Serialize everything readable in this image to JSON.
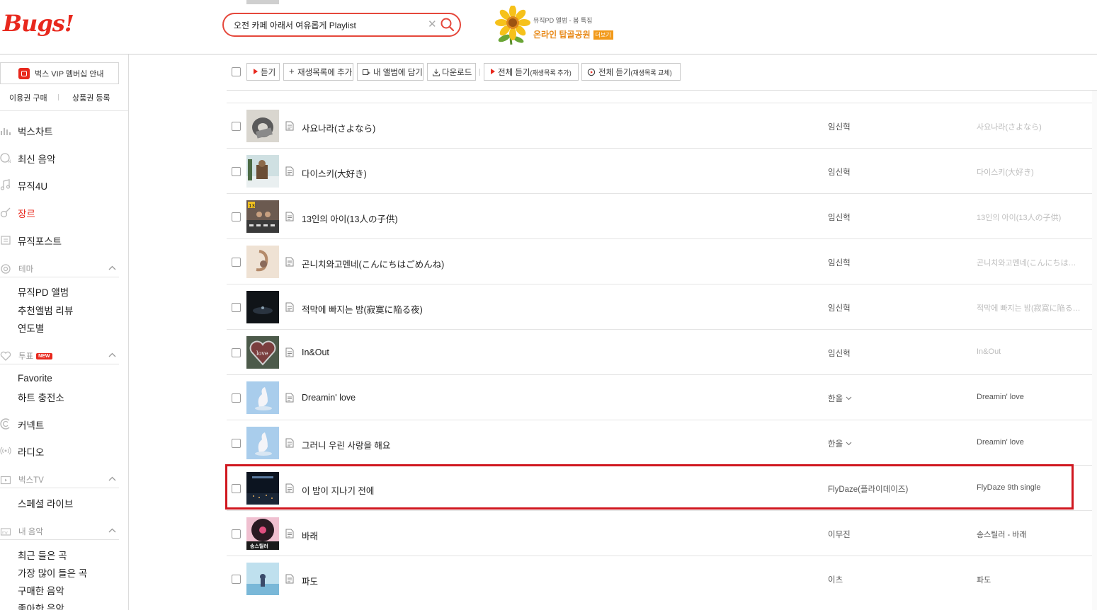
{
  "header": {
    "logo": "Bugs!",
    "search": {
      "value": "오전 카페 아래서 여유롭게 Playlist",
      "placeholder": ""
    },
    "banner": {
      "subtitle": "뮤직PD 앨범 - 봄 특집",
      "title": "온라인 탑골공원",
      "more": "더보기"
    }
  },
  "sidebar": {
    "vip": "벅스 VIP 멤버십 안내",
    "buy": "이용권 구매",
    "coupon": "상품권 등록",
    "nav": [
      "벅스차트",
      "최신 음악",
      "뮤직4U",
      "장르",
      "뮤직포스트"
    ],
    "theme": {
      "label": "테마",
      "items": [
        "뮤직PD 앨범",
        "추천앨범 리뷰",
        "연도별"
      ]
    },
    "vote": {
      "label": "투표",
      "badge": "NEW",
      "items": [
        "Favorite",
        "하트 충전소"
      ]
    },
    "connect": "커넥트",
    "radio": "라디오",
    "bugstv": {
      "label": "벅스TV",
      "items": [
        "스페셜 라이브"
      ]
    },
    "mymusic": {
      "label": "내 음악",
      "items": [
        "최근 들은 곡",
        "가장 많이 들은 곡",
        "구매한 음악",
        "좋아한 음악"
      ]
    }
  },
  "toolbar": {
    "listen": "듣기",
    "add_playlist": "재생목록에 추가",
    "add_album": "내 앨범에 담기",
    "download": "다운로드",
    "listen_all_add": "전체 듣기",
    "listen_all_add_small": "(재생목록 추가)",
    "listen_all_replace": "전체 듣기",
    "listen_all_replace_small": "(재생목록 교체)"
  },
  "tracks": [
    {
      "title": "사요나라(さよなら)",
      "artist": "임신혁",
      "album": "사요나라(さよなら)",
      "artist_more": false,
      "album_dark": false
    },
    {
      "title": "다이스키(大好き)",
      "artist": "임신혁",
      "album": "다이스키(大好き)",
      "artist_more": false,
      "album_dark": false
    },
    {
      "title": "13인의 아이(13人の子供)",
      "artist": "임신혁",
      "album": "13인의 아이(13人の子供)",
      "artist_more": false,
      "album_dark": false
    },
    {
      "title": "곤니치와고멘네(こんにちはごめんね)",
      "artist": "임신혁",
      "album": "곤니치와고멘네(こんにちはご…",
      "artist_more": false,
      "album_dark": false
    },
    {
      "title": "적막에 빠지는 밤(寂寞に陥る夜)",
      "artist": "임신혁",
      "album": "적막에 빠지는 밤(寂寞に陥る夜)",
      "artist_more": false,
      "album_dark": false
    },
    {
      "title": "In&Out",
      "artist": "임신혁",
      "album": "In&Out",
      "artist_more": false,
      "album_dark": false
    },
    {
      "title": "Dreamin' love",
      "artist": "한올",
      "album": "Dreamin' love",
      "artist_more": true,
      "album_dark": true
    },
    {
      "title": "그러니 우린 사랑을 해요",
      "artist": "한올",
      "album": "Dreamin' love",
      "artist_more": true,
      "album_dark": true
    },
    {
      "title": "이 밤이 지나기 전에",
      "artist": "FlyDaze(플라이데이즈)",
      "album": "FlyDaze 9th single",
      "artist_more": false,
      "album_dark": true
    },
    {
      "title": "바래",
      "artist": "이무진",
      "album": "송스틸러 - 바래",
      "artist_more": false,
      "album_dark": true
    },
    {
      "title": "파도",
      "artist": "이츠",
      "album": "파도",
      "artist_more": false,
      "album_dark": true
    }
  ],
  "colors": {
    "accent": "#e8281d",
    "highlight_box": "#d0171f"
  }
}
